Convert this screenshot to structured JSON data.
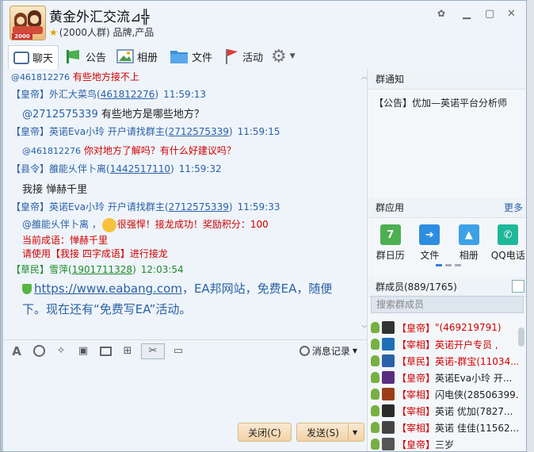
{
  "window": {
    "title": "黄金外汇交流⊿╬",
    "subtitle": "(2000人群) 品牌,产品",
    "avatar_badge": "2000"
  },
  "toolbar": {
    "chat": "聊天",
    "notice": "公告",
    "album": "相册",
    "file": "文件",
    "activity": "活动"
  },
  "chat": {
    "l0_id": "@461812276",
    "l0_text": "有些地方接不上",
    "l1_rank": "【皇帝】",
    "l1_name": "外汇大菜鸟(",
    "l1_qq": "461812276",
    "l1_close": ")",
    "l1_time": "11:59:13",
    "l2_mention": "@2712575339",
    "l2_text": "有些地方是哪些地方？",
    "l3_rank": "【皇帝】",
    "l3_name": "英诺Eva小玲 开户请找群主(",
    "l3_qq": "2712575339",
    "l3_close": ")",
    "l3_time": "11:59:15",
    "l4_id": "@461812276",
    "l4_text": "你对地方了解吗？有什么好建议吗？",
    "l5_rank": "【县令】",
    "l5_name": "雒能乆伴卜离(",
    "l5_qq": "1442517110",
    "l5_close": ")",
    "l5_time": "11:59:32",
    "l6_text": "我接 惮赫千里",
    "l7_rank": "【皇帝】",
    "l7_name": "英诺Eva小玲 开户请找群主(",
    "l7_qq": "2712575339",
    "l7_close": ")",
    "l7_time": "11:59:33",
    "l8_mention": "@雒能乆伴卜离 ，",
    "l8_text": "很强悍！接龙成功！奖励积分：100",
    "l9_text": "当前成语：惮赫千里",
    "l10_text": "请使用【我接  四字成语】进行接龙",
    "l11_rank": "【草民】",
    "l11_name": "雪萍(",
    "l11_qq": "1901711328",
    "l11_close": ")",
    "l11_time": "12:03:54",
    "l12_link": "https://www.eabang.com",
    "l12_text": "，EA邦网站，免费EA，随便",
    "l13_text": "下。现在还有“免费写EA”活动。"
  },
  "input": {
    "history": "消息记录",
    "close_btn": "关闭(C)",
    "send_btn": "发送(S)"
  },
  "notice": {
    "header": "群通知",
    "item": "【公告】优加—英诺平台分析师"
  },
  "apps": {
    "header": "群应用",
    "more": "更多",
    "calendar": "群日历",
    "calendar_day": "7",
    "file": "文件",
    "album": "相册",
    "qqphone": "QQ电话"
  },
  "members": {
    "header": "群成员(889/1765)",
    "search_placeholder": "搜索群成员",
    "list": [
      {
        "rank": "【皇帝】",
        "name": "\"(469219791)"
      },
      {
        "rank": "【宰相】",
        "name": "英诺开户专员 ,"
      },
      {
        "rank": "【草民】",
        "name": "英诺-群宝(11034..."
      },
      {
        "rank": "【皇帝】",
        "name": "英诺Eva小玲 开..."
      },
      {
        "rank": "【宰相】",
        "name": "闪电侠(28506399..."
      },
      {
        "rank": "【宰相】",
        "name": "英诺   优加(7827..."
      },
      {
        "rank": "【宰相】",
        "name": "英诺  佳佳(11562..."
      },
      {
        "rank": "【皇帝】",
        "name": "三岁"
      }
    ]
  },
  "colors": {
    "accent": "#2b61a8",
    "alert": "#d20000",
    "button": "#f2d2a6"
  }
}
